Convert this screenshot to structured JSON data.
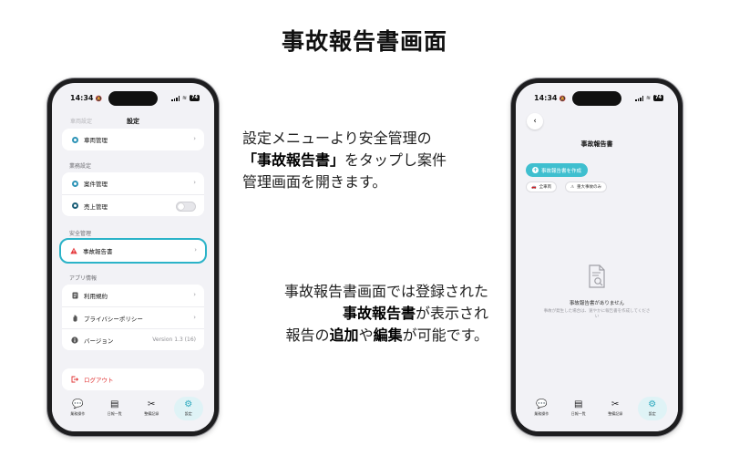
{
  "page_title": "事故報告書画面",
  "left_phone": {
    "status": {
      "time": "14:34",
      "battery": "74"
    },
    "faded_label": "車両設定",
    "screen_title": "設定",
    "sections": {
      "vehicle_item": "車両管理",
      "business_label": "業務設定",
      "project_item": "案件管理",
      "sales_item": "売上管理",
      "safety_label": "安全管理",
      "accident_item": "事故報告書",
      "app_info_label": "アプリ情報",
      "terms_item": "利用規約",
      "privacy_item": "プライバシーポリシー",
      "version_item": "バージョン",
      "version_value": "Version 1.3 (16)",
      "logout_item": "ログアウト"
    },
    "tabs": [
      "業務操作",
      "日報一覧",
      "整備記録",
      "設定"
    ]
  },
  "right_phone": {
    "status": {
      "time": "14:34",
      "battery": "74"
    },
    "screen_title": "事故報告書",
    "create_button": "事故報告書を作成",
    "filters": [
      "全車両",
      "重大事故のみ"
    ],
    "empty_title": "事故報告書がありません",
    "empty_sub": "事故が発生した場合は、速やかに報告書を作成してください",
    "tabs": [
      "業務操作",
      "日報一覧",
      "整備記録",
      "設定"
    ]
  },
  "description1": {
    "line1": "設定メニューより安全管理の",
    "line2_bold": "「事故報告書」",
    "line2_rest": "をタップし案件",
    "line3": "管理画面を開きます。"
  },
  "description2": {
    "line1": "事故報告書画面では登録された",
    "line2_bold": "事故報告書",
    "line2_rest": "が表示され",
    "line3_a": "報告の",
    "line3_b": "追加",
    "line3_c": "や",
    "line3_d": "編集",
    "line3_e": "が可能です。"
  }
}
